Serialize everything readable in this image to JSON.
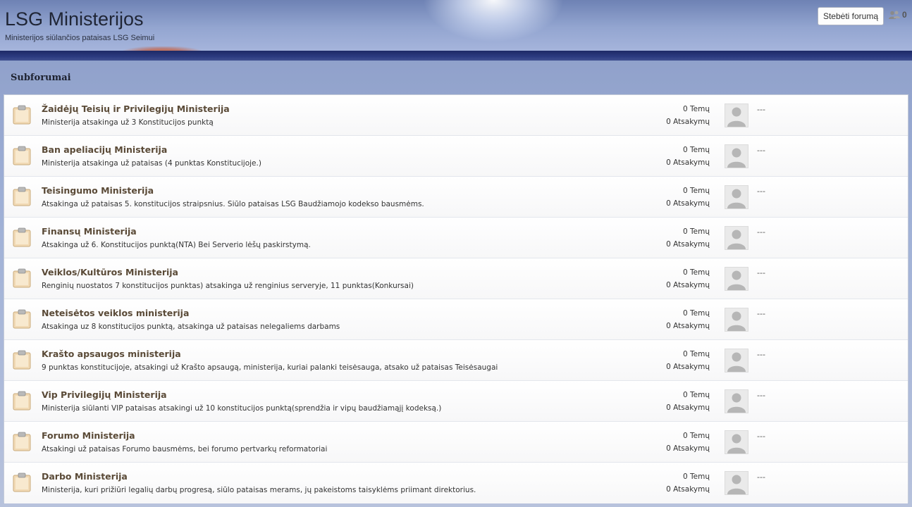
{
  "header": {
    "title": "LSG Ministerijos",
    "subtitle": "Ministerijos siūlančios pataisas LSG Seimui",
    "watch_button": "Stebėti forumą",
    "watchers_count": "0"
  },
  "section": {
    "title": "Subforumai"
  },
  "icons": {
    "forum": "clipboard-icon",
    "avatar": "user-silhouette-icon",
    "watchers": "users-icon"
  },
  "colors": {
    "forum_title": "#5a4a37",
    "clipboard": "#f1d9b4"
  },
  "forums": [
    {
      "name": "Žaidėjų Teisių ir Privilegijų Ministerija",
      "desc": "Ministerija atsakinga už 3 Konstitucijos punktą",
      "topics": "0 Temų",
      "replies": "0 Atsakymų",
      "last": "---"
    },
    {
      "name": "Ban apeliacijų Ministerija",
      "desc": "Ministerija atsakinga už pataisas (4 punktas Konstitucijoje.)",
      "topics": "0 Temų",
      "replies": "0 Atsakymų",
      "last": "---"
    },
    {
      "name": "Teisingumo Ministerija",
      "desc": "Atsakinga už pataisas 5. konstitucijos straipsnius. Siūlo pataisas LSG Baudžiamojo kodekso bausmėms.",
      "topics": "0 Temų",
      "replies": "0 Atsakymų",
      "last": "---"
    },
    {
      "name": "Finansų Ministerija",
      "desc": "Atsakinga už 6. Konstitucijos punktą(NTA) Bei Serverio lėšų paskirstymą.",
      "topics": "0 Temų",
      "replies": "0 Atsakymų",
      "last": "---"
    },
    {
      "name": "Veiklos/Kultūros Ministerija",
      "desc": "Renginių nuostatos 7 konstitucijos punktas) atsakinga už renginius serveryje, 11 punktas(Konkursai)",
      "topics": "0 Temų",
      "replies": "0 Atsakymų",
      "last": "---"
    },
    {
      "name": "Neteisėtos veiklos ministerija",
      "desc": "Atsakinga uz 8 konstitucijos punktą, atsakinga už pataisas nelegaliems darbams",
      "topics": "0 Temų",
      "replies": "0 Atsakymų",
      "last": "---"
    },
    {
      "name": "Krašto apsaugos ministerija",
      "desc": "9 punktas konstitucijoje, atsakingi už Krašto apsaugą, ministerija, kuriai palanki teisėsauga, atsako už pataisas Teisėsaugai",
      "topics": "0 Temų",
      "replies": "0 Atsakymų",
      "last": "---"
    },
    {
      "name": "Vip Privilegijų Ministerija",
      "desc": "Ministerija siūlanti VIP pataisas atsakingi už 10 konstitucijos punktą(sprendžia ir vipų baudžiamąjį kodeksą.)",
      "topics": "0 Temų",
      "replies": "0 Atsakymų",
      "last": "---"
    },
    {
      "name": "Forumo Ministerija",
      "desc": "Atsakingi už pataisas Forumo bausmėms, bei forumo pertvarkų reformatoriai",
      "topics": "0 Temų",
      "replies": "0 Atsakymų",
      "last": "---"
    },
    {
      "name": "Darbo Ministerija",
      "desc": "Ministerija, kuri prižiūri legalių darbų progresą, siūlo pataisas merams, jų pakeistoms taisyklėms priimant direktorius.",
      "topics": "0 Temų",
      "replies": "0 Atsakymų",
      "last": "---"
    }
  ]
}
